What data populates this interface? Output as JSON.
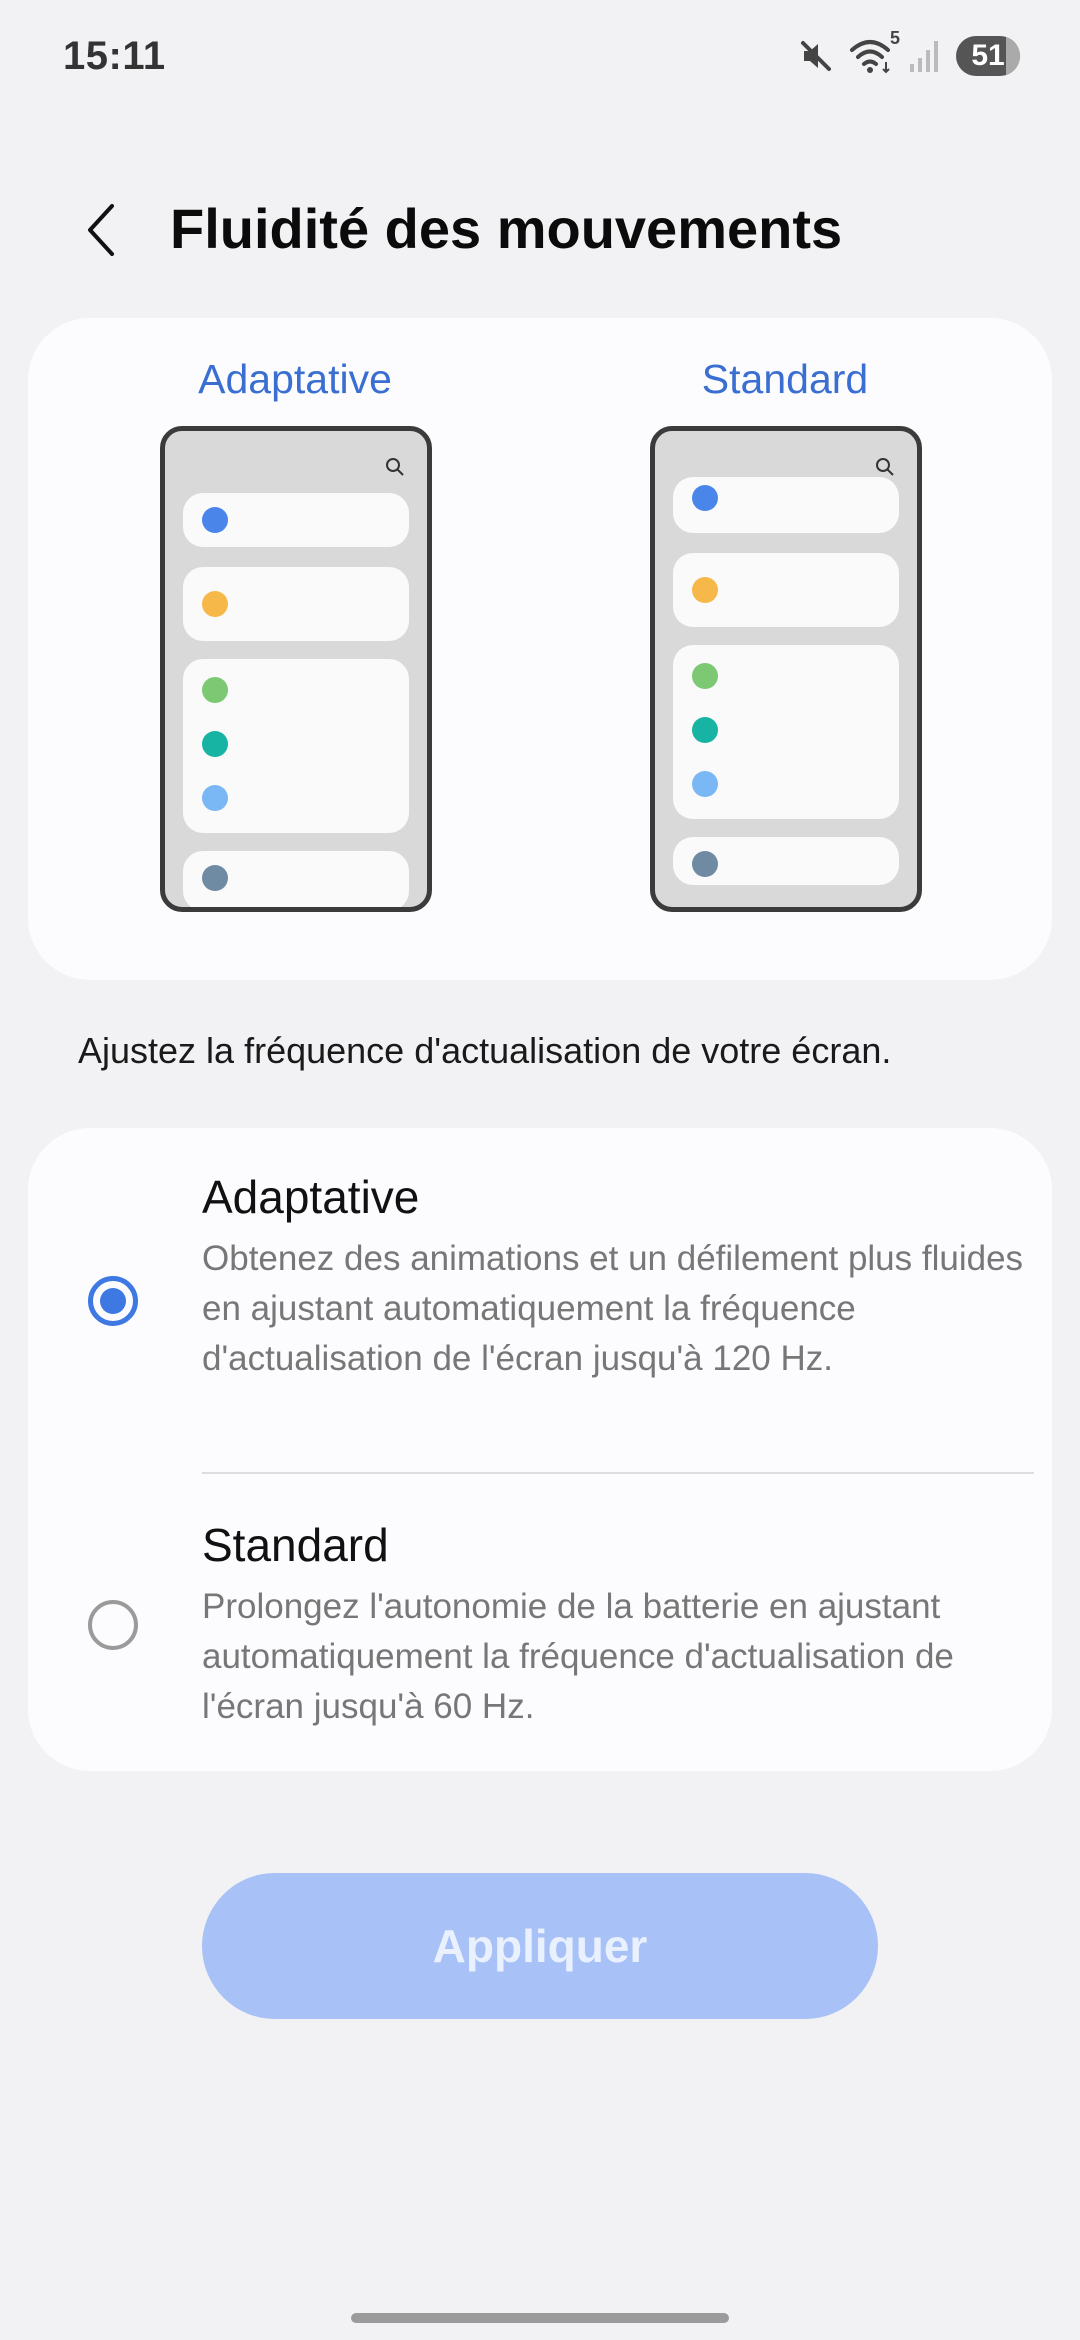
{
  "status_bar": {
    "time": "15:11",
    "battery": "51",
    "wifi_badge": "5",
    "icons": [
      "mute-icon",
      "wifi-icon",
      "signal-icon",
      "battery-icon"
    ]
  },
  "header": {
    "title": "Fluidité des mouvements",
    "back_icon": "chevron-left-icon"
  },
  "preview": {
    "adaptive_label": "Adaptative",
    "standard_label": "Standard",
    "dot_colors": [
      "#4a86ea",
      "#f7b84a",
      "#7cc873",
      "#17b3a3",
      "#7ab7f5",
      "#6f8aa3"
    ]
  },
  "description": "Ajustez la fréquence d'actualisation de votre écran.",
  "options": [
    {
      "title": "Adaptative",
      "description": "Obtenez des animations et un défilement plus fluides en ajustant automatiquement la fréquence d'actualisation de l'écran jusqu'à 120 Hz.",
      "selected": true
    },
    {
      "title": "Standard",
      "description": "Prolongez l'autonomie de la batterie en ajustant automatiquement la fréquence d'actualisation de l'écran jusqu'à 60 Hz.",
      "selected": false
    }
  ],
  "apply_label": "Appliquer",
  "colors": {
    "accent": "#3d78e3",
    "apply_button": "#a8c1f6",
    "label_blue": "#3a6fd1"
  }
}
